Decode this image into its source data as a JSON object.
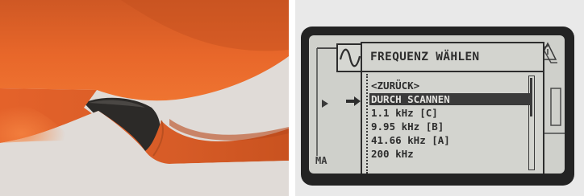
{
  "photo": {
    "subject": "device-casing-closeup",
    "colors": {
      "casing": "#e8672a",
      "casing_shadow": "#b84818",
      "grip": "#2c2a28",
      "background": "#e0dbd7"
    }
  },
  "lcd": {
    "title": "FREQUENZ WÄHLEN",
    "side_label": "MA",
    "wave_icon": "sine-wave-icon",
    "selection_icon": "arrow-right-icon",
    "items": [
      {
        "label": "<ZURÜCK>",
        "selected": false
      },
      {
        "label": "DURCH SCANNEN",
        "selected": true
      },
      {
        "label": "1.1 kHz [C]",
        "selected": false
      },
      {
        "label": "9.95 kHz [B]",
        "selected": false
      },
      {
        "label": "41.66 kHz [A]",
        "selected": false
      },
      {
        "label": "200 kHz",
        "selected": false
      }
    ],
    "colors": {
      "screen": "#cfd0cb",
      "text": "#2d2d2d",
      "highlight_bg": "#3a3a3a",
      "highlight_text": "#e4e4e0",
      "frame": "#232323"
    }
  }
}
